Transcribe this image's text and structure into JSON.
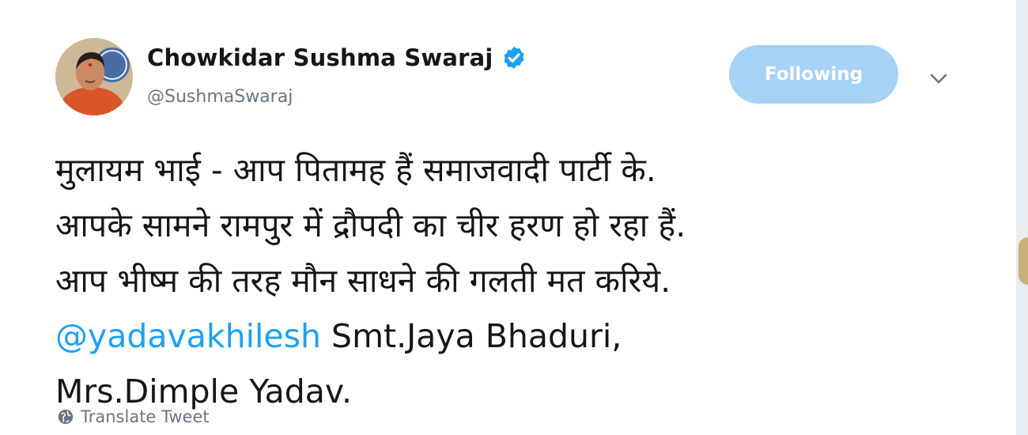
{
  "user": {
    "display_name": "Chowkidar Sushma Swaraj",
    "handle": "@SushmaSwaraj",
    "verified": true
  },
  "actions": {
    "follow_label": "Following"
  },
  "tweet": {
    "lines": [
      "मुलायम भाई - आप पितामह हैं समाजवादी पार्टी के.",
      "आपके सामने रामपुर में द्रौपदी का चीर हरण हो रहा हैं.",
      "आप भीष्म की तरह मौन साधने की गलती मत करिये."
    ],
    "mention": "@yadavakhilesh",
    "after_mention": " Smt.Jaya Bhaduri,",
    "last_line": "Mrs.Dimple Yadav."
  },
  "translate_label": "Translate Tweet",
  "colors": {
    "accent": "#1da1f2",
    "follow_button_bg": "#a6d2f6",
    "muted": "#657786"
  },
  "icons": {
    "verified": "verified-badge-icon",
    "caret": "chevron-down-icon",
    "translate": "globe-icon"
  }
}
